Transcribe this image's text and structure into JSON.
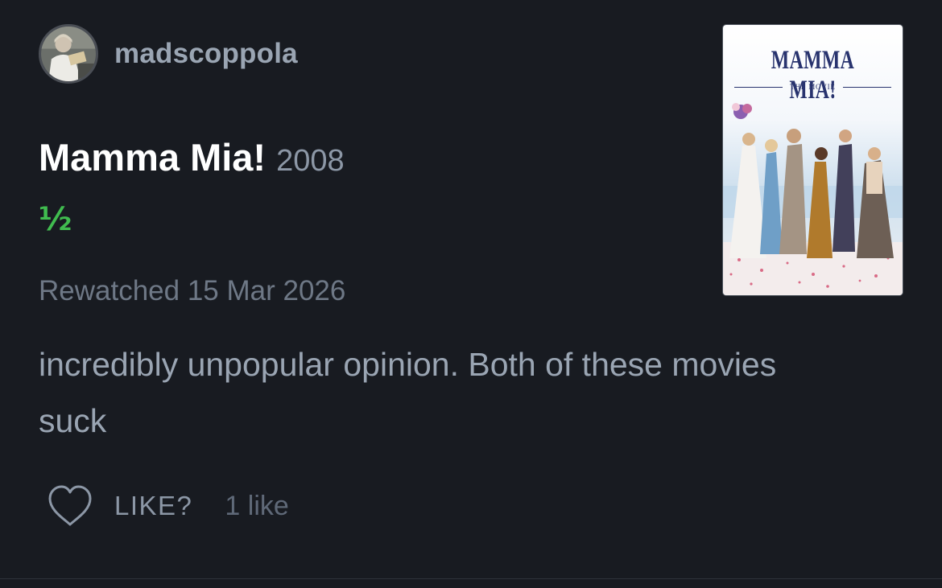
{
  "author": {
    "username": "madscoppola"
  },
  "film": {
    "title": "Mamma Mia!",
    "year": "2008",
    "rating": "½",
    "poster": {
      "title": "MAMMA MIA!",
      "subtitle": "THE MOVIE"
    }
  },
  "review": {
    "watch_date": "Rewatched 15 Mar 2026",
    "body": "incredibly unpopular opinion. Both of these movies suck"
  },
  "actions": {
    "like_icon": "heart-icon",
    "like_label": "LIKE?",
    "like_count": "1 like"
  },
  "colors": {
    "background": "#181b21",
    "rating_green": "#40bc4f",
    "poster_title": "#28336e"
  }
}
